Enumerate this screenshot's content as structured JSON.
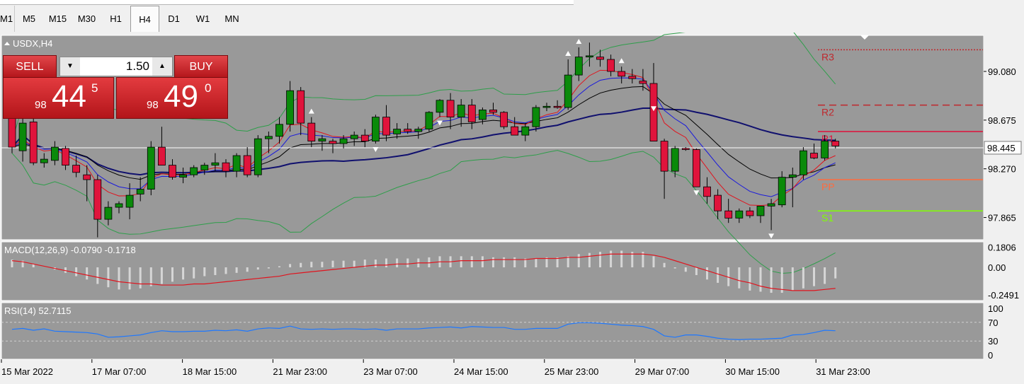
{
  "timeframes": [
    "M1",
    "M5",
    "M15",
    "M30",
    "H1",
    "H4",
    "D1",
    "W1",
    "MN"
  ],
  "active_timeframe": "H4",
  "symbol_label": "USDX,H4",
  "trade_panel": {
    "sell_label": "SELL",
    "buy_label": "BUY",
    "lot": "1.50",
    "sell_prefix": "98",
    "sell_big": "44",
    "sell_sup": "5",
    "buy_prefix": "98",
    "buy_big": "49",
    "buy_sup": "0"
  },
  "chart_data": {
    "type": "candlestick",
    "title": "USDX,H4",
    "ylim": [
      97.68,
      99.38
    ],
    "y_ticks": [
      "99.080",
      "98.675",
      "98.270",
      "97.865"
    ],
    "current_price_label": "98.445",
    "current_price": 98.445,
    "pivots": [
      {
        "name": "R3",
        "value": 99.26,
        "color": "#c0282d",
        "style": "dotted"
      },
      {
        "name": "R2",
        "value": 98.8,
        "color": "#c0282d",
        "style": "dashed"
      },
      {
        "name": "R1",
        "value": 98.58,
        "color": "#e0103a",
        "style": "solid"
      },
      {
        "name": "PP",
        "value": 98.18,
        "color": "#ff6a3d",
        "style": "solid"
      },
      {
        "name": "S1",
        "value": 97.92,
        "color": "#7fff00",
        "style": "solid"
      }
    ],
    "x_labels": [
      "15 Mar 2022",
      "17 Mar 07:00",
      "18 Mar 15:00",
      "21 Mar 23:00",
      "23 Mar 07:00",
      "24 Mar 15:00",
      "25 Mar 23:00",
      "29 Mar 07:00",
      "30 Mar 15:00",
      "31 Mar 23:00"
    ],
    "candles": [
      [
        98.75,
        98.85,
        98.4,
        98.45
      ],
      [
        98.42,
        98.7,
        98.33,
        98.65
      ],
      [
        98.66,
        98.7,
        98.3,
        98.32
      ],
      [
        98.32,
        98.4,
        98.28,
        98.35
      ],
      [
        98.34,
        98.5,
        98.3,
        98.45
      ],
      [
        98.44,
        98.46,
        98.26,
        98.3
      ],
      [
        98.3,
        98.38,
        98.2,
        98.24
      ],
      [
        98.22,
        98.3,
        98.0,
        98.18
      ],
      [
        98.18,
        98.22,
        97.7,
        97.85
      ],
      [
        97.85,
        98.0,
        97.8,
        97.95
      ],
      [
        97.95,
        98.0,
        97.9,
        97.98
      ],
      [
        97.95,
        98.15,
        97.85,
        98.05
      ],
      [
        98.06,
        98.2,
        98.0,
        98.1
      ],
      [
        98.1,
        98.5,
        98.05,
        98.45
      ],
      [
        98.45,
        98.62,
        98.3,
        98.3
      ],
      [
        98.3,
        98.35,
        98.18,
        98.2
      ],
      [
        98.2,
        98.28,
        98.15,
        98.22
      ],
      [
        98.22,
        98.3,
        98.2,
        98.28
      ],
      [
        98.26,
        98.32,
        98.22,
        98.3
      ],
      [
        98.3,
        98.4,
        98.25,
        98.32
      ],
      [
        98.32,
        98.35,
        98.2,
        98.25
      ],
      [
        98.25,
        98.4,
        98.2,
        98.38
      ],
      [
        98.38,
        98.45,
        98.2,
        98.22
      ],
      [
        98.22,
        98.55,
        98.2,
        98.52
      ],
      [
        98.52,
        98.58,
        98.4,
        98.54
      ],
      [
        98.54,
        98.7,
        98.48,
        98.64
      ],
      [
        98.64,
        99.0,
        98.58,
        98.92
      ],
      [
        98.92,
        98.95,
        98.55,
        98.65
      ],
      [
        98.65,
        98.7,
        98.45,
        98.5
      ],
      [
        98.5,
        98.55,
        98.42,
        98.52
      ],
      [
        98.5,
        98.52,
        98.4,
        98.48
      ],
      [
        98.48,
        98.55,
        98.44,
        98.52
      ],
      [
        98.52,
        98.58,
        98.46,
        98.55
      ],
      [
        98.55,
        98.6,
        98.45,
        98.5
      ],
      [
        98.5,
        98.72,
        98.48,
        98.7
      ],
      [
        98.7,
        98.8,
        98.5,
        98.55
      ],
      [
        98.56,
        98.65,
        98.52,
        98.6
      ],
      [
        98.6,
        98.65,
        98.56,
        98.58
      ],
      [
        98.58,
        98.62,
        98.52,
        98.6
      ],
      [
        98.6,
        98.75,
        98.58,
        98.74
      ],
      [
        98.74,
        98.85,
        98.7,
        98.84
      ],
      [
        98.84,
        98.9,
        98.6,
        98.7
      ],
      [
        98.7,
        98.85,
        98.62,
        98.8
      ],
      [
        98.8,
        98.85,
        98.6,
        98.66
      ],
      [
        98.68,
        98.78,
        98.64,
        98.76
      ],
      [
        98.76,
        98.82,
        98.72,
        98.74
      ],
      [
        98.74,
        98.75,
        98.6,
        98.62
      ],
      [
        98.62,
        98.7,
        98.55,
        98.55
      ],
      [
        98.55,
        98.65,
        98.5,
        98.62
      ],
      [
        98.62,
        98.8,
        98.58,
        98.78
      ],
      [
        98.78,
        98.82,
        98.75,
        98.79
      ],
      [
        98.79,
        98.84,
        98.77,
        98.78
      ],
      [
        98.78,
        99.18,
        98.76,
        99.05
      ],
      [
        99.05,
        99.28,
        99.0,
        99.2
      ],
      [
        99.2,
        99.32,
        99.12,
        99.21
      ],
      [
        99.2,
        99.26,
        99.12,
        99.18
      ],
      [
        99.18,
        99.22,
        99.04,
        99.08
      ],
      [
        99.08,
        99.12,
        98.98,
        99.04
      ],
      [
        99.04,
        99.1,
        98.98,
        99.02
      ],
      [
        99.0,
        99.1,
        98.92,
        98.98
      ],
      [
        98.98,
        99.15,
        98.82,
        98.5
      ],
      [
        98.5,
        98.52,
        98.02,
        98.25
      ],
      [
        98.25,
        98.46,
        98.2,
        98.44
      ],
      [
        98.44,
        98.45,
        98.42,
        98.43
      ],
      [
        98.43,
        98.44,
        98.12,
        98.12
      ],
      [
        98.12,
        98.2,
        97.98,
        98.04
      ],
      [
        98.05,
        98.1,
        97.85,
        97.92
      ],
      [
        97.92,
        98.02,
        97.82,
        97.86
      ],
      [
        97.86,
        97.94,
        97.82,
        97.92
      ],
      [
        97.92,
        97.95,
        97.86,
        97.88
      ],
      [
        97.88,
        97.96,
        97.82,
        97.96
      ],
      [
        97.96,
        98.02,
        97.76,
        97.98
      ],
      [
        97.97,
        98.25,
        97.95,
        98.2
      ],
      [
        98.2,
        98.28,
        97.95,
        98.22
      ],
      [
        98.22,
        98.45,
        98.18,
        98.42
      ],
      [
        98.4,
        98.48,
        98.35,
        98.36
      ],
      [
        98.36,
        98.55,
        98.34,
        98.5
      ],
      [
        98.5,
        98.52,
        98.44,
        98.46
      ]
    ],
    "macd": {
      "label": "MACD(12,26,9) -0.0790 -0.1718",
      "ylim": [
        -0.3,
        0.23
      ],
      "y_ticks": [
        "0.1806",
        "0.00",
        "-0.2491"
      ],
      "histogram": [
        0.07,
        0.06,
        0.03,
        0.0,
        -0.02,
        -0.05,
        -0.08,
        -0.11,
        -0.15,
        -0.18,
        -0.2,
        -0.2,
        -0.19,
        -0.17,
        -0.15,
        -0.13,
        -0.11,
        -0.1,
        -0.08,
        -0.07,
        -0.06,
        -0.05,
        -0.04,
        -0.02,
        -0.01,
        0.01,
        0.03,
        0.04,
        0.05,
        0.05,
        0.06,
        0.06,
        0.06,
        0.07,
        0.07,
        0.08,
        0.08,
        0.08,
        0.08,
        0.09,
        0.1,
        0.1,
        0.1,
        0.1,
        0.1,
        0.09,
        0.09,
        0.09,
        0.08,
        0.08,
        0.09,
        0.09,
        0.1,
        0.12,
        0.13,
        0.14,
        0.15,
        0.15,
        0.14,
        0.14,
        0.1,
        0.04,
        -0.01,
        -0.04,
        -0.07,
        -0.11,
        -0.14,
        -0.17,
        -0.19,
        -0.21,
        -0.22,
        -0.23,
        -0.23,
        -0.21,
        -0.19,
        -0.17,
        -0.15,
        -0.1
      ],
      "signal": [
        0.06,
        0.05,
        0.03,
        0.01,
        -0.01,
        -0.03,
        -0.05,
        -0.07,
        -0.09,
        -0.11,
        -0.13,
        -0.14,
        -0.15,
        -0.15,
        -0.16,
        -0.16,
        -0.16,
        -0.15,
        -0.15,
        -0.14,
        -0.13,
        -0.12,
        -0.11,
        -0.1,
        -0.09,
        -0.08,
        -0.06,
        -0.05,
        -0.04,
        -0.03,
        -0.02,
        -0.01,
        0.0,
        0.01,
        0.02,
        0.02,
        0.03,
        0.03,
        0.04,
        0.04,
        0.05,
        0.05,
        0.06,
        0.06,
        0.06,
        0.07,
        0.07,
        0.07,
        0.07,
        0.08,
        0.08,
        0.08,
        0.09,
        0.09,
        0.1,
        0.11,
        0.12,
        0.12,
        0.12,
        0.12,
        0.11,
        0.09,
        0.06,
        0.03,
        0.0,
        -0.03,
        -0.06,
        -0.09,
        -0.12,
        -0.14,
        -0.17,
        -0.19,
        -0.2,
        -0.21,
        -0.21,
        -0.21,
        -0.2,
        -0.19
      ]
    },
    "rsi": {
      "label": "RSI(14) 52.7115",
      "ylim": [
        0,
        100
      ],
      "y_ticks": [
        "100",
        "70",
        "30",
        "0"
      ],
      "values": [
        55,
        57,
        53,
        56,
        51,
        50,
        49,
        48,
        45,
        38,
        39,
        41,
        43,
        48,
        52,
        50,
        50,
        51,
        51,
        53,
        52,
        54,
        51,
        56,
        58,
        57,
        62,
        56,
        55,
        56,
        55,
        56,
        56,
        55,
        56,
        53,
        56,
        56,
        56,
        58,
        59,
        60,
        58,
        61,
        60,
        59,
        59,
        55,
        55,
        57,
        57,
        57,
        66,
        69,
        69,
        68,
        66,
        64,
        63,
        61,
        55,
        41,
        38,
        43,
        43,
        40,
        36,
        34,
        33,
        34,
        34,
        35,
        36,
        43,
        44,
        48,
        53,
        52
      ]
    }
  }
}
